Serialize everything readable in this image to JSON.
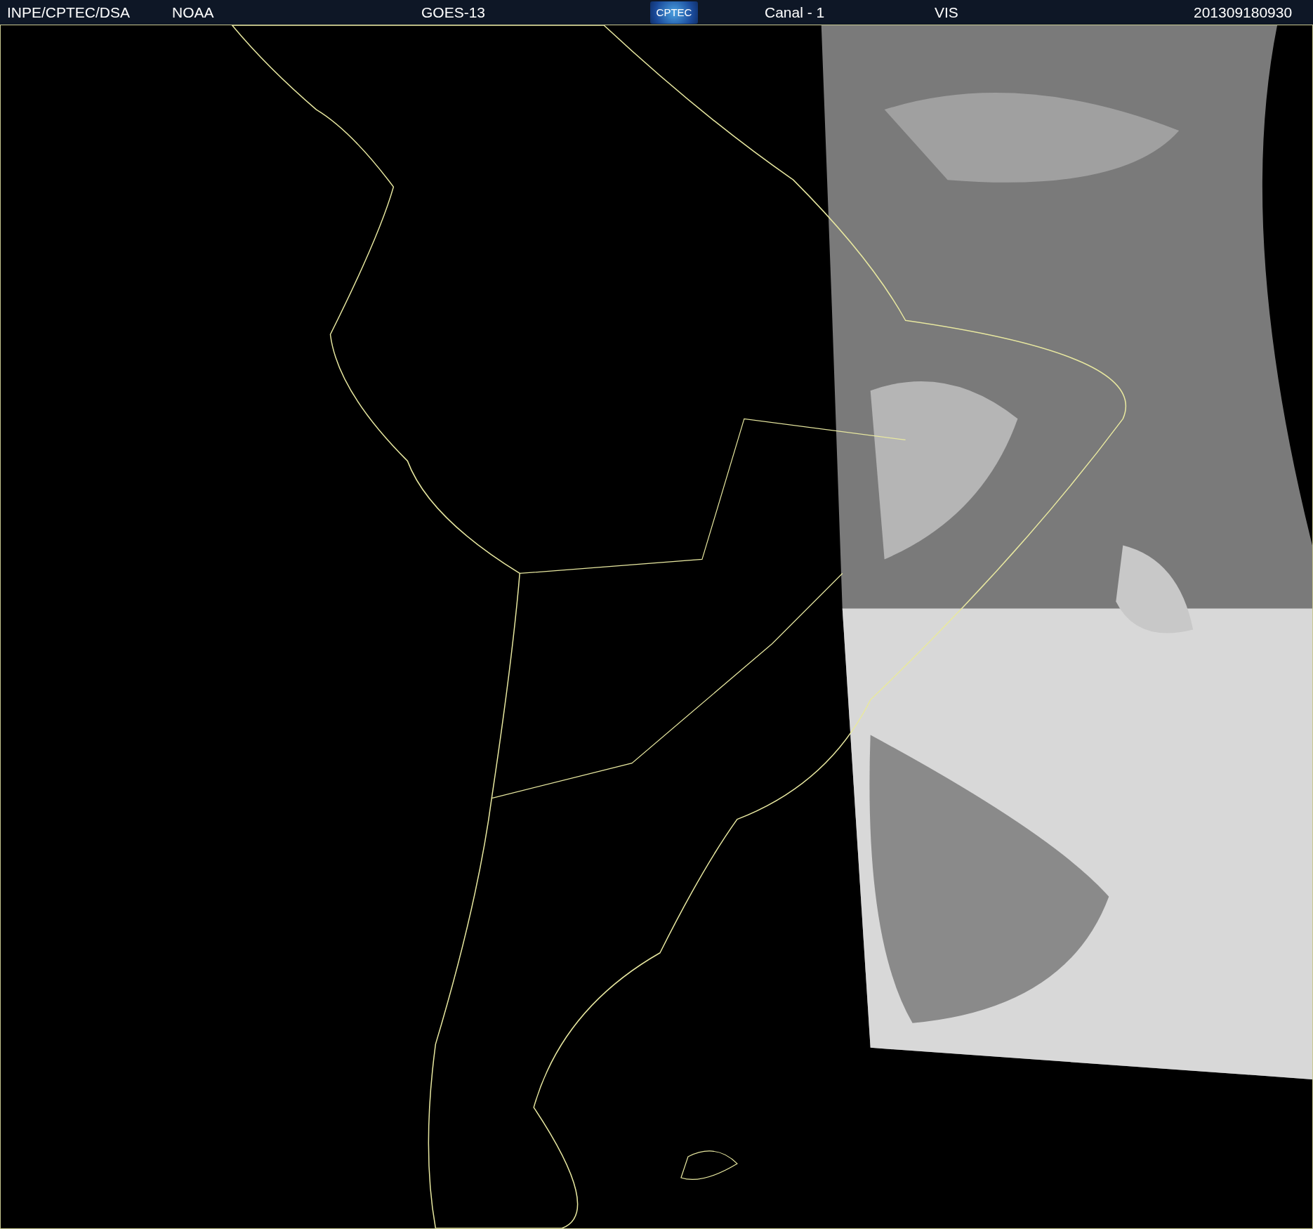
{
  "header": {
    "source": "INPE/CPTEC/DSA",
    "agency": "NOAA",
    "satellite": "GOES-13",
    "logo": "CPTEC",
    "channel": "Canal - 1",
    "band": "VIS",
    "timestamp": "201309180930"
  }
}
